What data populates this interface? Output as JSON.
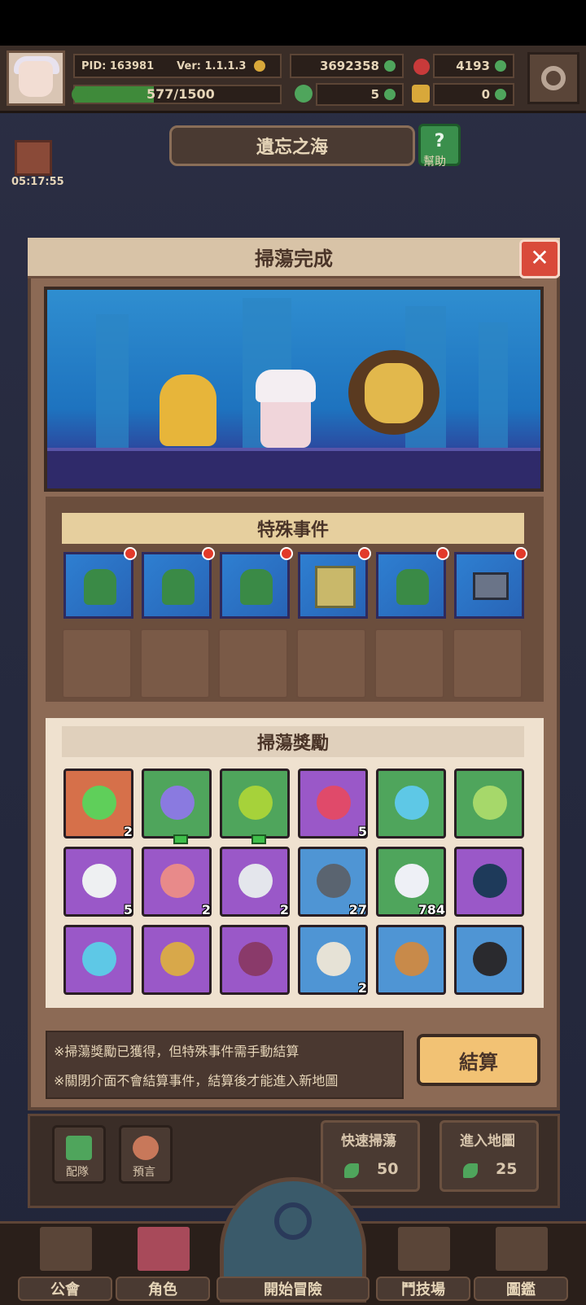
{
  "header": {
    "pid": "PID: 163981",
    "version": "Ver: 1.1.1.3",
    "gold": "3692358",
    "gems": "4193",
    "exp_text": "577/1500",
    "exp_fraction": 0.385,
    "clover": "5",
    "shoe": "0"
  },
  "map": {
    "title": "遺忘之海",
    "help_label": "幫助"
  },
  "gift": {
    "timer": "05:17:55"
  },
  "dialog": {
    "title": "掃蕩完成",
    "close": "✕",
    "events_title": "特殊事件",
    "events": [
      {
        "kind": "goblin"
      },
      {
        "kind": "goblin"
      },
      {
        "kind": "goblin"
      },
      {
        "kind": "scroll"
      },
      {
        "kind": "goblin"
      },
      {
        "kind": "chest"
      }
    ],
    "rewards_title": "掃蕩獎勵",
    "rewards": [
      {
        "icon": "clover-icon",
        "bg": "#d6704a",
        "color": "#5fcf5a",
        "qty": "2",
        "dot": false
      },
      {
        "icon": "crystal-orb-icon",
        "bg": "#4fa55c",
        "color": "#8a7ae0",
        "qty": "",
        "dot": true
      },
      {
        "icon": "green-gem-icon",
        "bg": "#4fa55c",
        "color": "#a6d23a",
        "qty": "",
        "dot": true
      },
      {
        "icon": "berry-icon",
        "bg": "#9a58c8",
        "color": "#e04a6a",
        "qty": "5",
        "dot": false
      },
      {
        "icon": "blue-slime-icon",
        "bg": "#4fa55c",
        "color": "#5ec8e6",
        "qty": "",
        "dot": false
      },
      {
        "icon": "green-slime-icon",
        "bg": "#4fa55c",
        "color": "#a6d86a",
        "qty": "",
        "dot": false
      },
      {
        "icon": "fish-icon",
        "bg": "#9a58c8",
        "color": "#eef0f2",
        "qty": "5",
        "dot": false
      },
      {
        "icon": "meat-icon",
        "bg": "#9a58c8",
        "color": "#e88a8a",
        "qty": "2",
        "dot": false
      },
      {
        "icon": "rock-icon",
        "bg": "#9a58c8",
        "color": "#e4e6ec",
        "qty": "2",
        "dot": false
      },
      {
        "icon": "dark-fish-icon",
        "bg": "#4f95d4",
        "color": "#5a6470",
        "qty": "27",
        "dot": false
      },
      {
        "icon": "diamond-icon",
        "bg": "#4fa55c",
        "color": "#eef0f6",
        "qty": "784",
        "dot": false
      },
      {
        "icon": "dark-orb-icon",
        "bg": "#9a58c8",
        "color": "#1e3a5a",
        "qty": "",
        "dot": false
      },
      {
        "icon": "sword-icon",
        "bg": "#9a58c8",
        "color": "#5ec8e6",
        "qty": "",
        "dot": false
      },
      {
        "icon": "helmet-icon",
        "bg": "#9a58c8",
        "color": "#d8a84a",
        "qty": "",
        "dot": false
      },
      {
        "icon": "boots-icon",
        "bg": "#9a58c8",
        "color": "#8a3a6a",
        "qty": "",
        "dot": false
      },
      {
        "icon": "bow-icon",
        "bg": "#4f95d4",
        "color": "#e6e2d6",
        "qty": "2",
        "dot": false
      },
      {
        "icon": "spear-icon",
        "bg": "#4f95d4",
        "color": "#c88a4a",
        "qty": "",
        "dot": false
      },
      {
        "icon": "hood-icon",
        "bg": "#4f95d4",
        "color": "#2a2a2e",
        "qty": "",
        "dot": false
      }
    ],
    "notice_line1": "※掃蕩獎勵已獲得，但特殊事件需手動結算",
    "notice_line2": "※關閉介面不會結算事件，結算後才能進入新地圖",
    "settle_label": "結算"
  },
  "bottom": {
    "team_label": "配隊",
    "prophecy_label": "預言",
    "quick_sweep_label": "快速掃蕩",
    "quick_sweep_cost": "50",
    "enter_map_label": "進入地圖",
    "enter_map_cost": "25"
  },
  "nav": {
    "guild": "公會",
    "character": "角色",
    "adventure": "開始冒險",
    "arena": "鬥技場",
    "codex": "圖鑑"
  }
}
